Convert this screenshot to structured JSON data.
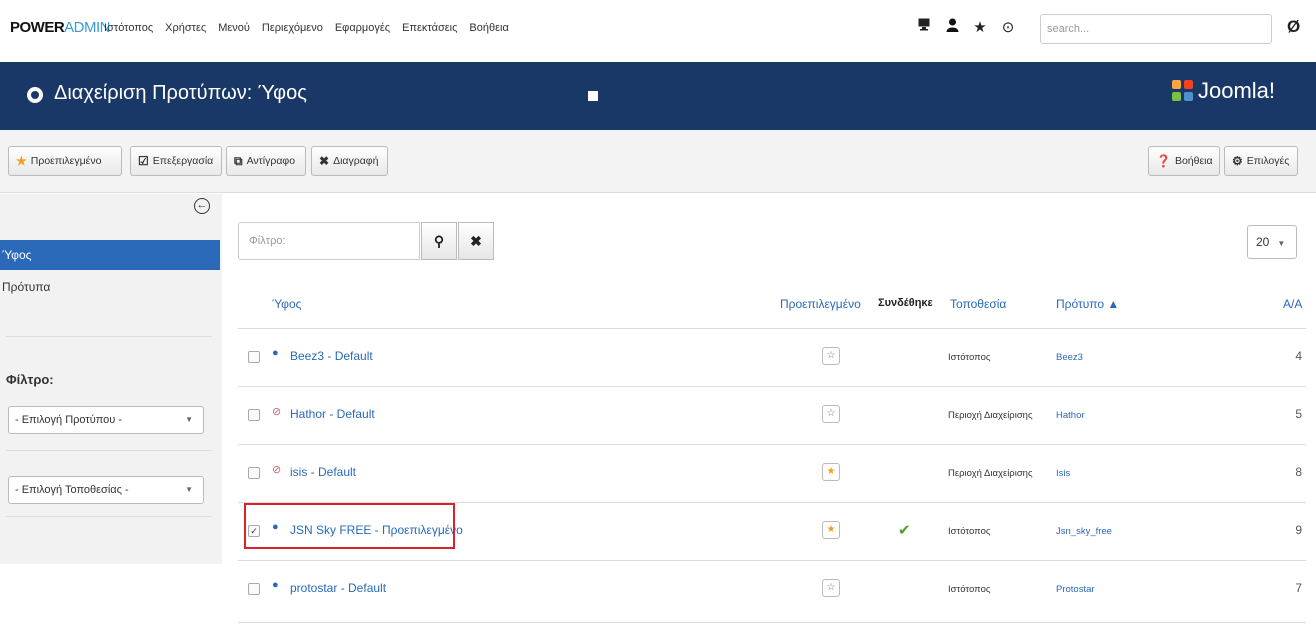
{
  "topnav": {
    "brand_bold": "POWER",
    "brand_light": "ADMIN",
    "menu": [
      "Ιστότοπος",
      "Χρήστες",
      "Μενού",
      "Περιεχόμενο",
      "Εφαρμογές",
      "Επεκτάσεις",
      "Βοήθεια"
    ],
    "icons": [
      "monitor-icon",
      "user-icon",
      "star-icon",
      "cog-icon"
    ],
    "search_placeholder": "search...",
    "right_glyph": "Ø"
  },
  "header": {
    "title": "Διαχείριση Προτύπων: Ύφος",
    "logo_text": "Joomla!"
  },
  "toolbar": {
    "default_label": "Προεπιλεγμένο",
    "edit_label": "Επεξεργασία",
    "copy_label": "Αντίγραφο",
    "delete_label": "Διαγραφή",
    "help_label": "Βοήθεια",
    "options_label": "Επιλογές"
  },
  "sidebar": {
    "items": [
      {
        "label": "Ύφος",
        "active": true
      },
      {
        "label": "Πρότυπα",
        "active": false
      }
    ],
    "filter_title": "Φίλτρο:",
    "select_template": "- Επιλογή Προτύπου -",
    "select_location": "- Επιλογή Τοποθεσίας -"
  },
  "filter": {
    "placeholder": "Φίλτρο:",
    "limit": "20"
  },
  "table": {
    "headers": {
      "style": "Ύφος",
      "default": "Προεπιλεγμένο",
      "assigned": "Συνδέθηκε",
      "location": "Τοποθεσία",
      "template": "Πρότυπο ▲",
      "id": "Α/Α"
    },
    "rows": [
      {
        "name": "Beez3 - Default",
        "icon": "eye-icon",
        "default": false,
        "assigned": false,
        "location": "Ιστότοπος",
        "template": "Beez3",
        "id": "4",
        "checked": false
      },
      {
        "name": "Hathor - Default",
        "icon": "admin-icon",
        "default": false,
        "assigned": false,
        "location": "Περιοχή Διαχείρισης",
        "template": "Hathor",
        "id": "5",
        "checked": false
      },
      {
        "name": "isis - Default",
        "icon": "admin-icon",
        "default": true,
        "assigned": false,
        "location": "Περιοχή Διαχείρισης",
        "template": "Isis",
        "id": "8",
        "checked": false
      },
      {
        "name": "JSN Sky FREE - Προεπιλεγμένο",
        "icon": "eye-icon",
        "default": true,
        "assigned": true,
        "location": "Ιστότοπος",
        "template": "Jsn_sky_free",
        "id": "9",
        "checked": true
      },
      {
        "name": "protostar - Default",
        "icon": "eye-icon",
        "default": false,
        "assigned": false,
        "location": "Ιστότοπος",
        "template": "Protostar",
        "id": "7",
        "checked": false
      }
    ]
  },
  "colors": {
    "header_bg": "#1a3867",
    "link": "#2a69b8",
    "active_sidebar": "#2a69b8",
    "star_on": "#f0a31a",
    "check": "#4a9e32",
    "highlight": "#d9232c"
  }
}
